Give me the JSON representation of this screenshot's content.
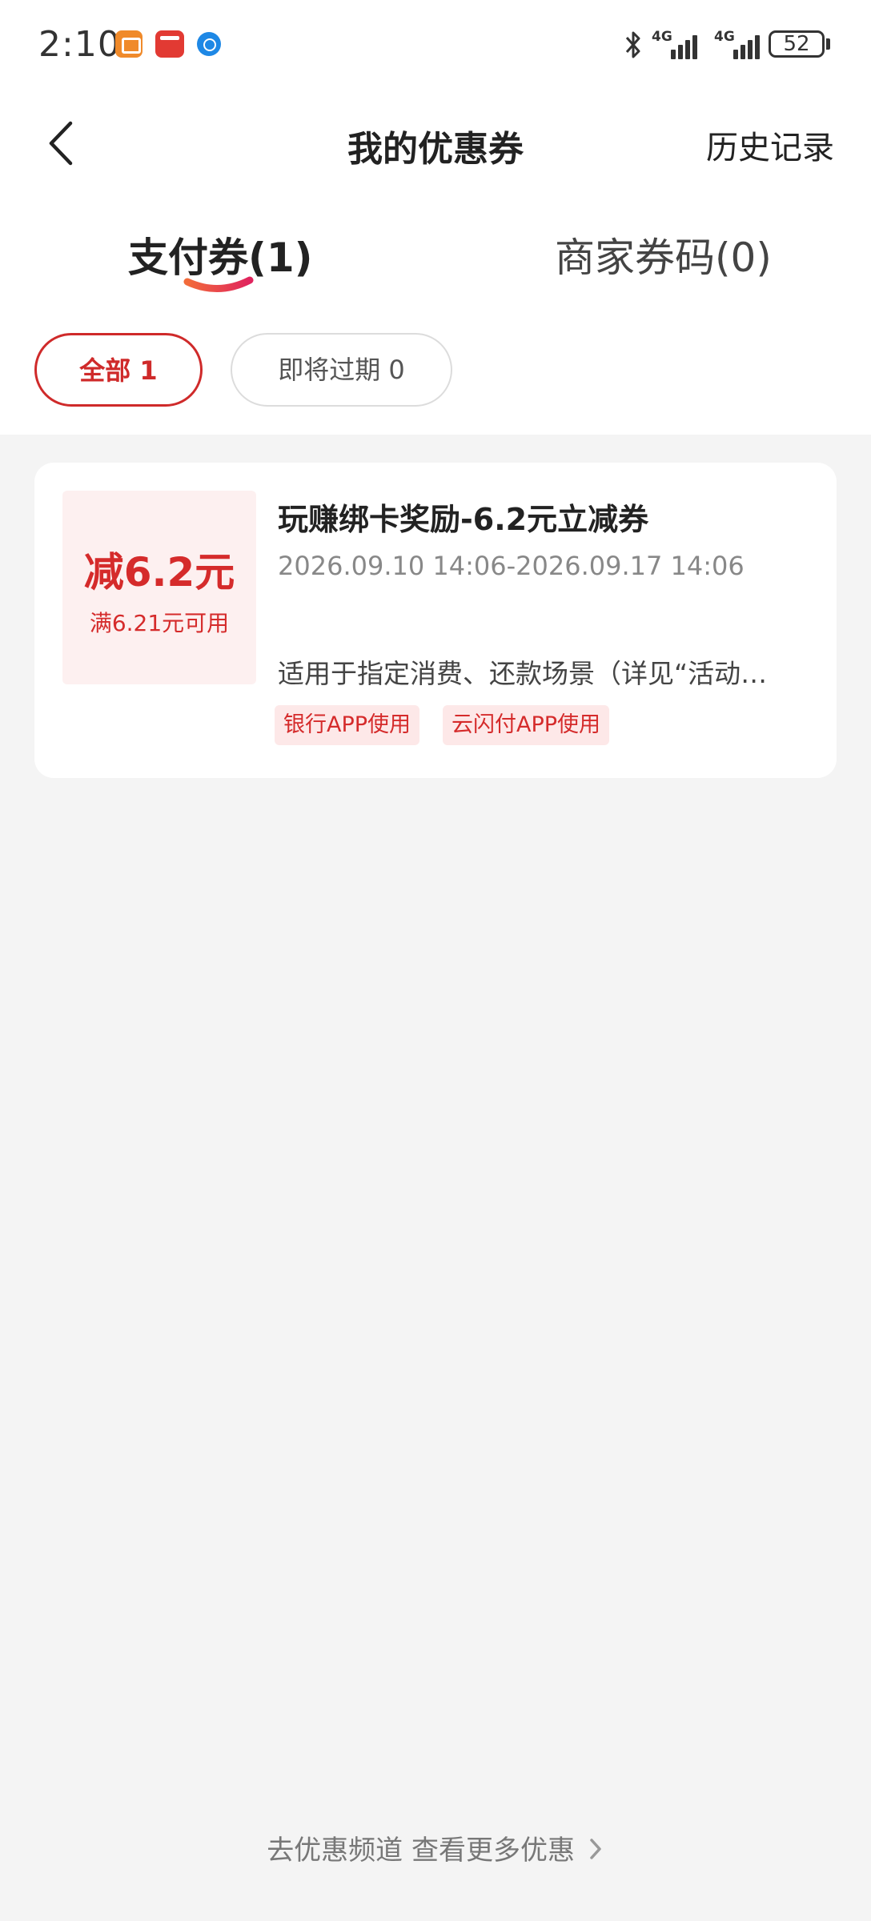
{
  "status_bar": {
    "time": "2:10",
    "network_1": "4G",
    "network_2": "4G",
    "battery": "52"
  },
  "header": {
    "title": "我的优惠券",
    "history": "历史记录"
  },
  "tabs": [
    {
      "label": "支付券(1)",
      "active": true
    },
    {
      "label": "商家券码(0)",
      "active": false
    }
  ],
  "filters": [
    {
      "label": "全部 1",
      "active": true
    },
    {
      "label": "即将过期 0",
      "active": false
    }
  ],
  "coupon": {
    "amount": "减6.2元",
    "condition": "满6.21元可用",
    "title": "玩赚绑卡奖励-6.2元立减券",
    "validity": "2026.09.10 14:06-2026.09.17 14:06",
    "description": "适用于指定消费、还款场景（详见“活动…",
    "tags": [
      "银行APP使用",
      "云闪付APP使用"
    ]
  },
  "footer": {
    "link": "去优惠频道 查看更多优惠"
  },
  "colors": {
    "accent": "#d52b2b",
    "background": "#f4f4f4"
  }
}
